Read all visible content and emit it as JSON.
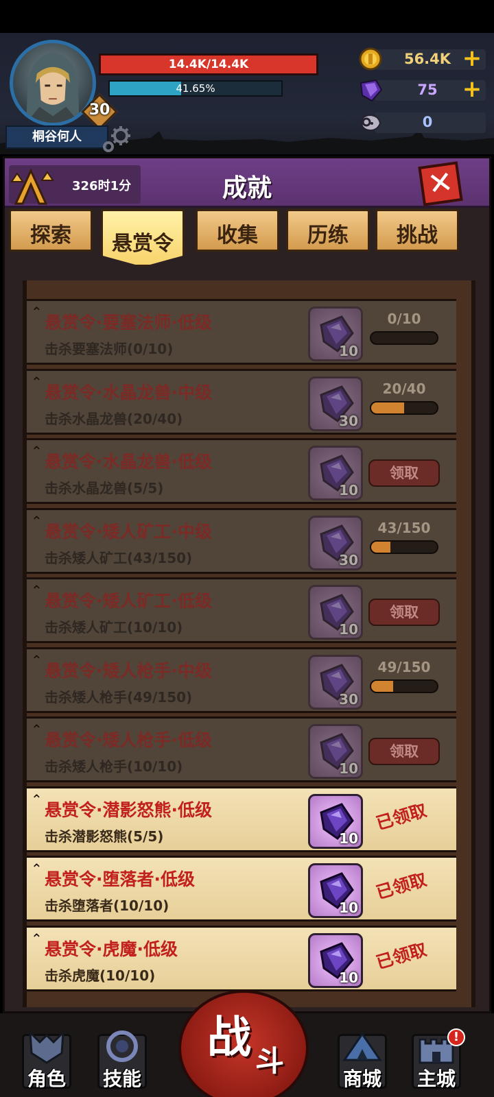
{
  "player": {
    "name": "桐谷何人",
    "level": "30",
    "hp_text": "14.4K/14.4K",
    "exp_text": "41.65%",
    "exp_percent": 41.65
  },
  "resources": {
    "gold": "56.4K",
    "gem": "75",
    "skull": "0",
    "plus": "+"
  },
  "panel": {
    "title": "成就",
    "timer": "326时1分",
    "close": "✕"
  },
  "tabs": [
    {
      "label": "探索",
      "active": false
    },
    {
      "label": "悬赏令",
      "active": true
    },
    {
      "label": "收集",
      "active": false
    },
    {
      "label": "历练",
      "active": false
    },
    {
      "label": "挑战",
      "active": false
    }
  ],
  "bounties": [
    {
      "title": "悬赏令·要塞法师·低级",
      "desc": "击杀要塞法师(0/10)",
      "reward": "10",
      "state": "progress",
      "progress_text": "0/10",
      "progress": 0.0
    },
    {
      "title": "悬赏令·水晶龙兽·中级",
      "desc": "击杀水晶龙兽(20/40)",
      "reward": "30",
      "state": "progress",
      "progress_text": "20/40",
      "progress": 0.5
    },
    {
      "title": "悬赏令·水晶龙兽·低级",
      "desc": "击杀水晶龙兽(5/5)",
      "reward": "10",
      "state": "claim",
      "button": "领取"
    },
    {
      "title": "悬赏令·矮人矿工·中级",
      "desc": "击杀矮人矿工(43/150)",
      "reward": "30",
      "state": "progress",
      "progress_text": "43/150",
      "progress": 0.29
    },
    {
      "title": "悬赏令·矮人矿工·低级",
      "desc": "击杀矮人矿工(10/10)",
      "reward": "10",
      "state": "claim",
      "button": "领取"
    },
    {
      "title": "悬赏令·矮人枪手·中级",
      "desc": "击杀矮人枪手(49/150)",
      "reward": "30",
      "state": "progress",
      "progress_text": "49/150",
      "progress": 0.33
    },
    {
      "title": "悬赏令·矮人枪手·低级",
      "desc": "击杀矮人枪手(10/10)",
      "reward": "10",
      "state": "claim",
      "button": "领取"
    },
    {
      "title": "悬赏令·潜影怒熊·低级",
      "desc": "击杀潜影怒熊(5/5)",
      "reward": "10",
      "state": "done",
      "stamp": "已领取"
    },
    {
      "title": "悬赏令·堕落者·低级",
      "desc": "击杀堕落者(10/10)",
      "reward": "10",
      "state": "done",
      "stamp": "已领取"
    },
    {
      "title": "悬赏令·虎魔·低级",
      "desc": "击杀虎魔(10/10)",
      "reward": "10",
      "state": "done",
      "stamp": "已领取"
    }
  ],
  "nav": {
    "character": "角色",
    "skills": "技能",
    "battle_main": "战",
    "battle_sub": "斗",
    "shop": "商城",
    "city": "主城",
    "alert": "!"
  },
  "icons": {
    "gold": "gold-coin-icon",
    "gem": "purple-crystal-icon",
    "skull": "ram-skull-icon",
    "settings": "gear-icon",
    "timer": "rank-arrows-icon"
  },
  "colors": {
    "hp": "#d8362a",
    "exp": "#2ea3c4",
    "panel_header": "#6e3e86",
    "active_tab": "#f8d46c",
    "claimed": "#c1201c"
  }
}
